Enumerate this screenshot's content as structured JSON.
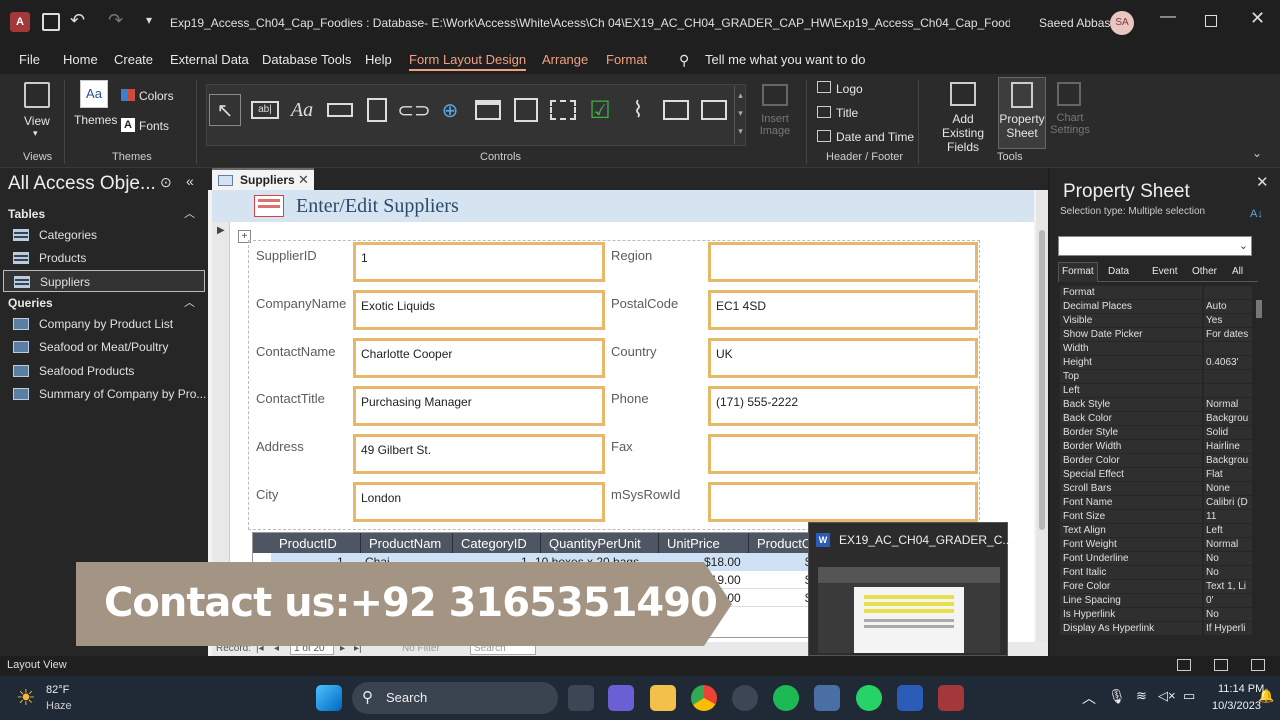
{
  "window": {
    "title": "Exp19_Access_Ch04_Cap_Foodies : Database- E:\\Work\\Access\\White\\Acess\\Ch 04\\EX19_AC_CH04_GRADER_CAP_HW\\Exp19_Access_Ch04_Cap_Foodies.accdb (Acces...",
    "user_name": "Saeed Abbas",
    "user_initials": "SA"
  },
  "menu": {
    "items": [
      "File",
      "Home",
      "Create",
      "External Data",
      "Database Tools",
      "Help",
      "Form Layout Design",
      "Arrange",
      "Format"
    ],
    "active": "Form Layout Design",
    "tell_me": "Tell me what you want to do"
  },
  "ribbon": {
    "view_label": "View",
    "themes_label": "Themes",
    "colors_label": "Colors",
    "fonts_label": "Fonts",
    "insert_image_label": "Insert Image",
    "logo_label": "Logo",
    "title_label": "Title",
    "date_time_label": "Date and Time",
    "add_existing_fields_label": "Add Existing Fields",
    "property_sheet_label": "Property Sheet",
    "chart_settings_label": "Chart Settings",
    "groups": {
      "views": "Views",
      "themes": "Themes",
      "controls": "Controls",
      "header_footer": "Header / Footer",
      "tools": "Tools"
    }
  },
  "nav_pane": {
    "title": "All Access Obje...",
    "tables_header": "Tables",
    "tables": [
      "Categories",
      "Products",
      "Suppliers"
    ],
    "selected": "Suppliers",
    "queries_header": "Queries",
    "queries": [
      "Company by Product List",
      "Seafood or Meat/Poultry",
      "Seafood Products",
      "Summary of Company by Pro..."
    ]
  },
  "document": {
    "tab_label": "Suppliers",
    "form_title": "Enter/Edit Suppliers",
    "fields_left": [
      {
        "label": "SupplierID",
        "value": "1"
      },
      {
        "label": "CompanyName",
        "value": "Exotic Liquids"
      },
      {
        "label": "ContactName",
        "value": "Charlotte Cooper"
      },
      {
        "label": "ContactTitle",
        "value": "Purchasing Manager"
      },
      {
        "label": "Address",
        "value": "49 Gilbert St."
      },
      {
        "label": "City",
        "value": "London"
      }
    ],
    "fields_right": [
      {
        "label": "Region",
        "value": ""
      },
      {
        "label": "PostalCode",
        "value": "EC1 4SD"
      },
      {
        "label": "Country",
        "value": "UK"
      },
      {
        "label": "Phone",
        "value": "(171) 555-2222"
      },
      {
        "label": "Fax",
        "value": ""
      },
      {
        "label": "mSysRowId",
        "value": ""
      }
    ],
    "subform": {
      "columns": [
        "ProductID",
        "ProductNam",
        "CategoryID",
        "QuantityPerUnit",
        "UnitPrice",
        "ProductCo"
      ],
      "rows": [
        [
          "1",
          "Chai",
          "1",
          "10 boxes x 20 bags",
          "$18.00",
          "$1"
        ],
        [
          "",
          "",
          "",
          "",
          "$19.00",
          "$1"
        ],
        [
          "",
          "",
          "",
          "",
          "$10.00",
          "$"
        ]
      ]
    },
    "record_nav": {
      "label": "Record:",
      "position": "1 of 20",
      "no_filter": "No Filter",
      "search": "Search"
    }
  },
  "overlay": {
    "contact_text": "Contact us:+92 3165351490",
    "thumb_title": "EX19_AC_CH04_GRADER_C..."
  },
  "property_sheet": {
    "title": "Property Sheet",
    "selection_type": "Selection type:  Multiple selection",
    "tabs": [
      "Format",
      "Data",
      "Event",
      "Other",
      "All"
    ],
    "active_tab": "Format",
    "properties": [
      [
        "Format",
        ""
      ],
      [
        "Decimal Places",
        "Auto"
      ],
      [
        "Visible",
        "Yes"
      ],
      [
        "Show Date Picker",
        "For dates"
      ],
      [
        "Width",
        ""
      ],
      [
        "Height",
        "0.4063'"
      ],
      [
        "Top",
        ""
      ],
      [
        "Left",
        ""
      ],
      [
        "Back Style",
        "Normal"
      ],
      [
        "Back Color",
        "Backgrou"
      ],
      [
        "Border Style",
        "Solid"
      ],
      [
        "Border Width",
        "Hairline"
      ],
      [
        "Border Color",
        "Backgrou"
      ],
      [
        "Special Effect",
        "Flat"
      ],
      [
        "Scroll Bars",
        "None"
      ],
      [
        "Font Name",
        "Calibri (D"
      ],
      [
        "Font Size",
        "11"
      ],
      [
        "Text Align",
        "Left"
      ],
      [
        "Font Weight",
        "Normal"
      ],
      [
        "Font Underline",
        "No"
      ],
      [
        "Font Italic",
        "No"
      ],
      [
        "Fore Color",
        "Text 1, Li"
      ],
      [
        "Line Spacing",
        "0'"
      ],
      [
        "Is Hyperlink",
        "No"
      ],
      [
        "Display As Hyperlink",
        "If Hyperli"
      ]
    ]
  },
  "status_bar": {
    "text": "Layout View"
  },
  "taskbar": {
    "weather_temp": "82°F",
    "weather_desc": "Haze",
    "search_label": "Search",
    "time": "11:14 PM",
    "date": "10/3/2023"
  },
  "colors": {
    "accent_orange": "#e7b76a",
    "active_tab_text": "#f0a080",
    "overlay_bg": "#a39483",
    "access_red": "#a4373a"
  }
}
